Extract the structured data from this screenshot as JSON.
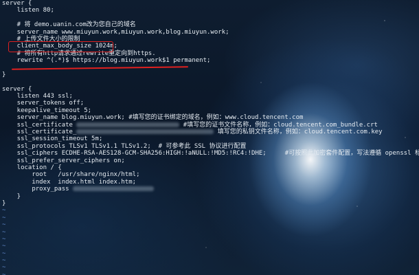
{
  "code_lines": [
    {
      "text": "server {"
    },
    {
      "text": "    listen 80;"
    },
    {
      "text": ""
    },
    {
      "text": "    # 将 demo.uanin.com改为您自己的域名"
    },
    {
      "text": "    server_name www.miuyun.work,miuyun.work,blog.miuyun.work;"
    },
    {
      "text": "    # 上传文件大小的限制"
    },
    {
      "text": "    client_max_body_size 1024m;"
    },
    {
      "text": "    # 将所有http请求通过rewrite重定向到https."
    },
    {
      "text": "    rewrite ^(.*)$ https://blog.miuyun.work$1 permanent;"
    },
    {
      "text": ""
    },
    {
      "text": "}"
    },
    {
      "text": ""
    },
    {
      "text": "server {"
    },
    {
      "text": "    listen 443 ssl;"
    },
    {
      "text": "    server_tokens off;"
    },
    {
      "text": "    keepalive_timeout 5;"
    },
    {
      "text": "    server_name blog.miuyun.work; #填写您的证书绑定的域名，例如：www.cloud.tencent.com"
    },
    {
      "text": "    ssl_certificate ",
      "blur_width": 150,
      "text_after": " #填写您的证书文件名称，例如：cloud.tencent.com_bundle.crt"
    },
    {
      "text": "    ssl_certificate_",
      "blur_width": 200,
      "text_after": " 填写您的私钥文件名称，例如：cloud.tencent.com.key"
    },
    {
      "text": "    ssl_session_timeout 5m;"
    },
    {
      "text": "    ssl_protocols TLSv1 TLSv1.1 TLSv1.2;  # 可参考此 SSL 协议进行配置"
    },
    {
      "text": "    ssl_ciphers ECDHE-RSA-AES128-GCM-SHA256:HIGH:!aNULL:!MD5:!RC4:!DHE;     #可按照此加密套件配置，写法遵循 openssl 标准"
    },
    {
      "text": "    ssl_prefer_server_ciphers on;"
    },
    {
      "text": "    location / {"
    },
    {
      "text": "        root   /usr/share/nginx/html;"
    },
    {
      "text": "        index  index.html index.htm;"
    },
    {
      "text": "        proxy_pass ",
      "blur_width": 118,
      "text_after": ""
    },
    {
      "text": "    }"
    },
    {
      "text": "}"
    },
    {
      "text": "~"
    },
    {
      "text": "~"
    },
    {
      "text": "~"
    },
    {
      "text": "~"
    },
    {
      "text": "~"
    },
    {
      "text": "~"
    },
    {
      "text": "~"
    },
    {
      "text": "~"
    },
    {
      "text": "~"
    },
    {
      "text": "~"
    }
  ],
  "colors": {
    "text": "#e6ecf2",
    "tilde": "#5f86c8",
    "annotation_red": "#e0201f"
  }
}
